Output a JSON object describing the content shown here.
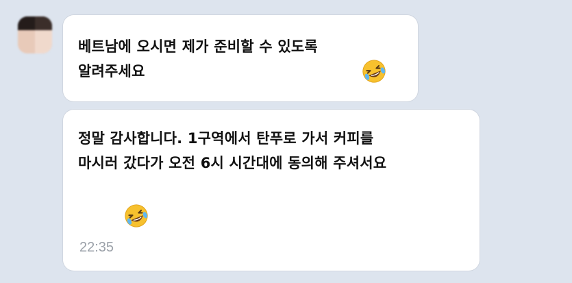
{
  "chat": {
    "messages": [
      {
        "text": "베트남에 오시면 제가 준비할 수 있도록\n알려주세요",
        "emoji": "rolling-on-floor-laughing"
      },
      {
        "text": "정말 감사합니다. 1구역에서 탄푸로 가서 커피를\n마시러 갔다가 오전 6시 시간대에 동의해 주셔서요",
        "emoji": "rolling-on-floor-laughing",
        "time": "22:35"
      }
    ]
  },
  "colors": {
    "background": "#dde4ee",
    "bubble": "#ffffff",
    "text": "#111111",
    "timestamp": "#9aa0a8",
    "emoji_face": "#f7c12e"
  }
}
